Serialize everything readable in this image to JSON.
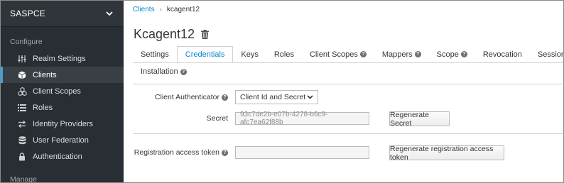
{
  "sidebar": {
    "realm_name": "SASPCE",
    "configure_label": "Configure",
    "manage_label": "Manage",
    "items": [
      {
        "label": "Realm Settings",
        "icon": "sliders-icon"
      },
      {
        "label": "Clients",
        "icon": "cube-icon"
      },
      {
        "label": "Client Scopes",
        "icon": "cubes-icon"
      },
      {
        "label": "Roles",
        "icon": "list-icon"
      },
      {
        "label": "Identity Providers",
        "icon": "exchange-icon"
      },
      {
        "label": "User Federation",
        "icon": "database-icon"
      },
      {
        "label": "Authentication",
        "icon": "lock-icon"
      }
    ],
    "active_item": "Clients"
  },
  "breadcrumb": {
    "parent": "Clients",
    "separator": "›",
    "current": "kcagent12"
  },
  "header": {
    "title": "Kcagent12"
  },
  "tabs": {
    "row1": [
      "Settings",
      "Credentials",
      "Keys",
      "Roles",
      "Client Scopes",
      "Mappers",
      "Scope",
      "Revocation",
      "Sessions"
    ],
    "row2": [
      "Installation"
    ],
    "active": "Credentials"
  },
  "form": {
    "client_authenticator_label": "Client Authenticator",
    "client_authenticator_value": "Client Id and Secret",
    "secret_label": "Secret",
    "secret_value": "93c7de2b-e07b-4278-b6c9-afc7ea62f88b",
    "regenerate_secret_label": "Regenerate Secret",
    "registration_token_label": "Registration access token",
    "registration_token_value": "",
    "regenerate_token_label": "Regenerate registration access token"
  },
  "colors": {
    "sidebar_bg": "#292e34",
    "accent": "#0088ce",
    "active_border": "#39a5dc"
  }
}
